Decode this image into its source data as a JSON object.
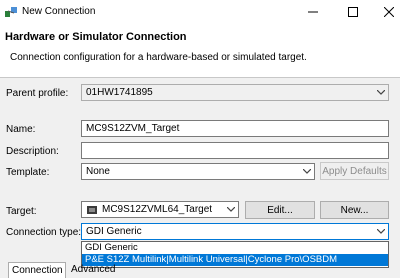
{
  "window": {
    "title": "New Connection",
    "icon": "eclipse-connection-icon"
  },
  "header": {
    "title": "Hardware or Simulator Connection",
    "subtitle": "Connection configuration for a hardware-based or simulated target."
  },
  "form": {
    "parent_profile": {
      "label": "Parent profile:",
      "value": "01HW1741895"
    },
    "name": {
      "label": "Name:",
      "value": "MC9S12ZVM_Target"
    },
    "description": {
      "label": "Description:",
      "value": ""
    },
    "template": {
      "label": "Template:",
      "value": "None",
      "apply_button": "Apply Defaults"
    },
    "target": {
      "label": "Target:",
      "value": "MC9S12ZVML64_Target",
      "edit_button": "Edit...",
      "new_button": "New..."
    },
    "connection_type": {
      "label": "Connection type:",
      "value": "GDI Generic",
      "options": [
        "GDI Generic",
        "P&E S12Z Multilink|Multilink Universal|Cyclone Pro\\OSBDM"
      ],
      "highlighted_index": 1
    }
  },
  "tabs": [
    {
      "label": "Connection",
      "active": true
    },
    {
      "label": "Advanced",
      "active": false
    }
  ]
}
